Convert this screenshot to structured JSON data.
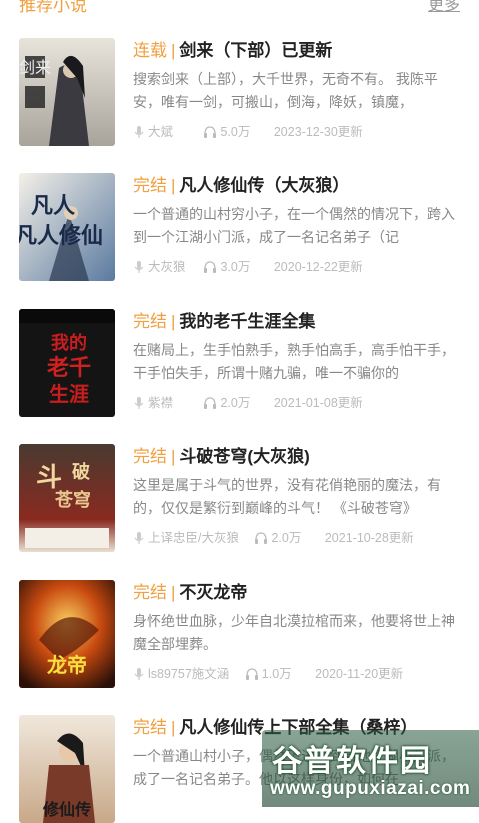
{
  "header": {
    "title": "推荐小说",
    "more_label": "更多"
  },
  "items": [
    {
      "status": "连载",
      "title": "剑来（下部）已更新",
      "desc": "搜索剑来（上部），大千世界，无奇不有。 我陈平安，唯有一剑，可搬山，倒海，降妖，镇魔，",
      "author": "大斌",
      "plays": "5.0万",
      "updated": "2023-12-30更新",
      "cover_text": "剑来"
    },
    {
      "status": "完结",
      "title": "凡人修仙传（大灰狼）",
      "desc": "一个普通的山村穷小子，在一个偶然的情况下，跨入到一个江湖小门派，成了一名记名弟子（记",
      "author": "大灰狼",
      "plays": "3.0万",
      "updated": "2020-12-22更新",
      "cover_text": "凡人修仙"
    },
    {
      "status": "完结",
      "title": "我的老千生涯全集",
      "desc": "在赌局上，生手怕熟手，熟手怕高手，高手怕干手，干手怕失手，所谓十赌九骗，唯一不骗你的",
      "author": "紫襟",
      "plays": "2.0万",
      "updated": "2021-01-08更新",
      "cover_text": "我的老千生涯"
    },
    {
      "status": "完结",
      "title": "斗破苍穹(大灰狼)",
      "desc": "这里是属于斗气的世界，没有花俏艳丽的魔法，有的，仅仅是繁衍到巅峰的斗气！ 《斗破苍穹》",
      "author": "上译忠臣/大灰狼",
      "plays": "2.0万",
      "updated": "2021-10-28更新",
      "cover_text": "斗破苍穹"
    },
    {
      "status": "完结",
      "title": "不灭龙帝",
      "desc": "身怀绝世血脉，少年自北漠拉棺而来，他要将世上神魔全部埋葬。",
      "author": "ls89757施文涵",
      "plays": "1.0万",
      "updated": "2020-11-20更新",
      "cover_text": "龙帝"
    },
    {
      "status": "完结",
      "title": "凡人修仙传上下部全集（桑梓）",
      "desc": "一个普通山村小子，偶然下进入到当地江湖小门派，成了一名记名弟子。他以这样身份，如何在",
      "author": "",
      "plays": "",
      "updated": "",
      "cover_text": "修仙传"
    }
  ],
  "watermark": {
    "title": "谷普软件园",
    "url": "www.gupuxiazai.com"
  },
  "colors": {
    "accent": "#f0a040",
    "title": "#222222",
    "desc": "#888888",
    "meta": "#bbbbbb"
  }
}
